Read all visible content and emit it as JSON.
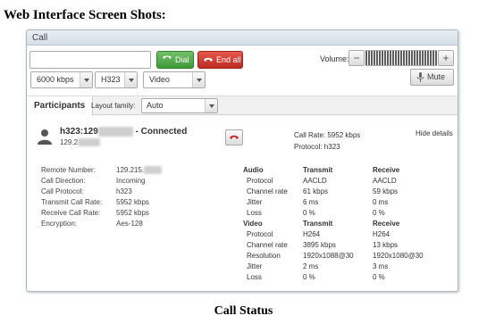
{
  "doc_title": "Web Interface Screen Shots:",
  "doc_caption": "Call Status",
  "window": {
    "title": "Call"
  },
  "toolbar": {
    "dial_input_value": "",
    "dial_label": "Dial",
    "end_all_label": "End all",
    "volume_label": "Volume:",
    "volume_minus": "−",
    "volume_plus": "+",
    "mute_label": "Mute"
  },
  "selects": {
    "rate": "6000 kbps",
    "protocol": "H323",
    "type": "Video"
  },
  "tabs": {
    "participants_label": "Participants",
    "layout_label": "Layout family:",
    "layout_value": "Auto"
  },
  "participant": {
    "name_prefix": "h323:129",
    "name_suffix": " - Connected",
    "address": "129.2",
    "summary_rate": "Call Rate: 5952 kbps",
    "summary_protocol": "Protocol: h323",
    "hide_details": "Hide details"
  },
  "details": [
    {
      "label": "Remote Number:",
      "value": "129.215."
    },
    {
      "label": "Call Direction:",
      "value": "Incoming"
    },
    {
      "label": "Call Protocol:",
      "value": "h323"
    },
    {
      "label": "Transmit Call Rate:",
      "value": "5952 kbps"
    },
    {
      "label": "Receive Call Rate:",
      "value": "5952 kbps"
    },
    {
      "label": "Encryption:",
      "value": "Aes-128"
    }
  ],
  "audio": {
    "header": [
      "Audio",
      "Transmit",
      "Receive"
    ],
    "rows": [
      [
        "Protocol",
        "AACLD",
        "AACLD"
      ],
      [
        "Channel rate",
        "61 kbps",
        "59 kbps"
      ],
      [
        "Jitter",
        "6 ms",
        "0 ms"
      ],
      [
        "Loss",
        "0 %",
        "0 %"
      ]
    ]
  },
  "video": {
    "header": [
      "Video",
      "Transmit",
      "Receive"
    ],
    "rows": [
      [
        "Protocol",
        "H264",
        "H264"
      ],
      [
        "Channel rate",
        "3895 kbps",
        "13 kbps"
      ],
      [
        "Resolution",
        "1920x1088@30",
        "1920x1080@30"
      ],
      [
        "Jitter",
        "2 ms",
        "3 ms"
      ],
      [
        "Loss",
        "0 %",
        "0 %"
      ]
    ]
  },
  "colors": {
    "dial": "#4aa543",
    "end_all": "#cc342b",
    "header_bg": "#dde5ec",
    "border": "#a9b8c4"
  },
  "icons": {
    "dial": "phone-icon",
    "end_all": "phone-hangup-icon",
    "mute": "microphone-icon",
    "avatar": "user-icon",
    "hangup": "phone-hangup-icon"
  }
}
